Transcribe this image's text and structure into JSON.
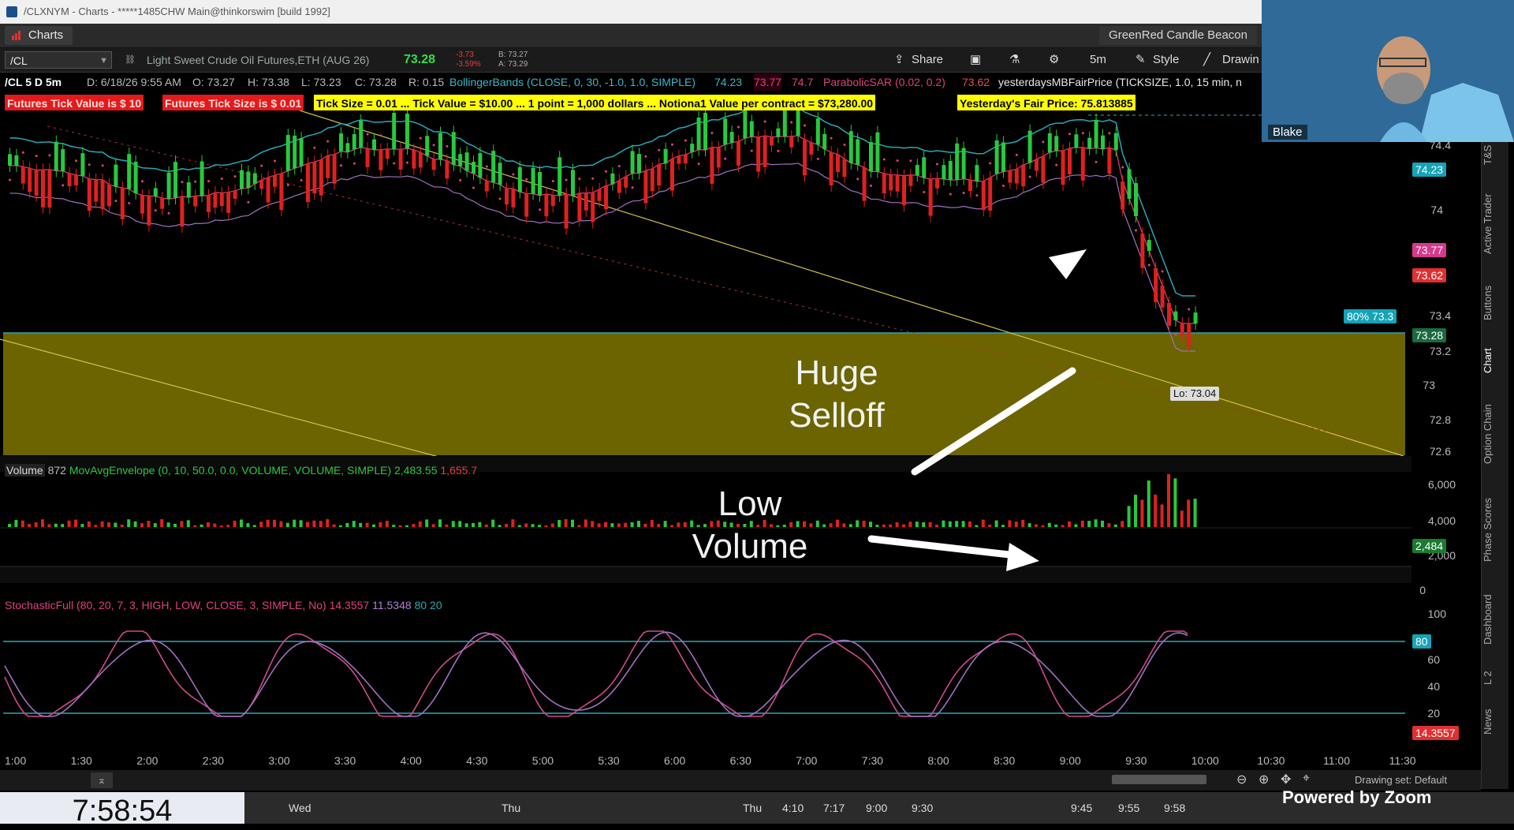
{
  "window": {
    "title": "/CLXNYM - Charts - *****1485CHW Main@thinkorswim [build 1992]"
  },
  "tabs": {
    "charts_label": "Charts",
    "beacon_label": "GreenRed Candle Beacon"
  },
  "toolbar": {
    "symbol": "/CL",
    "description": "Light Sweet Crude Oil Futures,ETH (AUG 26)",
    "last": "73.28",
    "change": "-3.73",
    "change_pct": "-3.59%",
    "bid": "B: 73.27",
    "ask": "A: 73.29",
    "share_label": "Share",
    "timeframe_label": "5m",
    "style_label": "Style",
    "drawings_label": "Drawin"
  },
  "studybar": {
    "chart_id": "/CL 5 D 5m",
    "date": "D: 6/18/26 9:55 AM",
    "open": "O: 73.27",
    "high": "H: 73.38",
    "low": "L: 73.23",
    "close": "C: 73.28",
    "range": "R: 0.15",
    "bb_label": "BollingerBands (CLOSE, 0, 30, -1.0, 1.0, SIMPLE)",
    "bb_v1": "74.23",
    "bb_v2": "73.77",
    "bb_v3": "74.7",
    "psar_label": "ParabolicSAR (0.02, 0.2)",
    "psar_v": "73.62",
    "fair_label": "yesterdaysMBFairPrice (TICKSIZE, 1.0, 15 min, n"
  },
  "infobar": {
    "tick_value": "Futures Tick Value is $ 10",
    "tick_size": "Futures Tick Size is $ 0.01",
    "summary": "Tick Size =  0.01 ... Tick Value =  $10.00 ... 1 point = 1,000 dollars ... Notiona1 Value per contract =  $73,280.00",
    "fair_price": "Yesterday's Fair Price: 75.813885"
  },
  "price_axis": {
    "ticks": [
      "74.4",
      "74",
      "73.4",
      "73.2",
      "73",
      "72.8",
      "72.6"
    ],
    "tag_bb_upper": "74.23",
    "tag_bb_mid": "73.77",
    "tag_psar": "73.62",
    "tag_pct": "80% 73.3",
    "tag_last": "73.28",
    "low_label": "Lo: 73.04"
  },
  "volume_panel": {
    "label": "Volume",
    "value": "872",
    "env_label": "MovAvgEnvelope (0, 10, 50.0, 0.0, VOLUME, VOLUME, SIMPLE)",
    "env_v1": "2,483.55",
    "env_v2": "1,655.7",
    "ticks": [
      "6,000",
      "4,000",
      "2,000",
      "0"
    ],
    "tag": "2,484"
  },
  "stoch_panel": {
    "label": "StochasticFull (80, 20, 7, 3, HIGH, LOW, CLOSE, 3, SIMPLE, No)",
    "v1": "14.3557",
    "v2": "11.5348",
    "v3": "80",
    "v4": "20",
    "ticks": [
      "100",
      "80",
      "60",
      "40",
      "20"
    ],
    "tag80": "80",
    "tag_val": "14.3557"
  },
  "time_axis": {
    "labels": [
      "1:00",
      "1:30",
      "2:00",
      "2:30",
      "3:00",
      "3:30",
      "4:00",
      "4:30",
      "5:00",
      "5:30",
      "6:00",
      "6:30",
      "7:00",
      "7:30",
      "8:00",
      "8:30",
      "9:00",
      "9:30",
      "10:00",
      "10:30",
      "11:00",
      "11:30"
    ]
  },
  "drawing_set": "Drawing set: Default",
  "annotations": {
    "selloff_line1": "Huge",
    "selloff_line2": "Selloff",
    "volume_line1": "Low",
    "volume_line2": "Volume"
  },
  "webcam": {
    "name": "Blake"
  },
  "clock": "7:58:54",
  "bottom": {
    "day1": "Wed",
    "day2": "Thu",
    "day3": "Thu",
    "times": [
      "4:10",
      "7:17",
      "9:00",
      "9:30",
      "9:45",
      "9:55",
      "9:58"
    ]
  },
  "watermark": "Powered by Zoom",
  "sidebar": {
    "items": [
      "T&S",
      "Active Trader",
      "Buttons",
      "Chart",
      "Option Chain",
      "Phase Scores",
      "Dashboard",
      "L 2",
      "News"
    ]
  },
  "colors": {
    "up": "#27c93f",
    "down": "#e02020",
    "zone": "#6b6400",
    "bb": "#2aa7b5",
    "psar": "#e0407a",
    "stoch_k": "#d04a8a",
    "stoch_d": "#a070c0"
  }
}
